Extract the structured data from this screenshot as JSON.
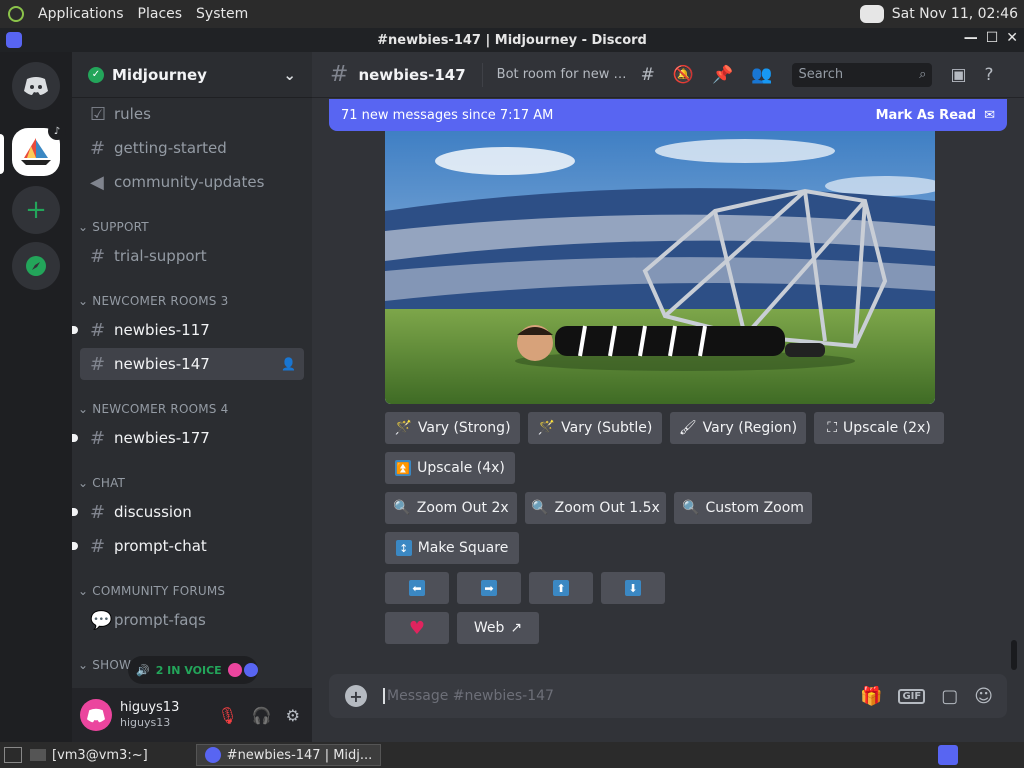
{
  "system_bar": {
    "menus": [
      "Applications",
      "Places",
      "System"
    ],
    "clock": "Sat Nov 11, 02:46"
  },
  "window": {
    "title": "#newbies-147 | Midjourney - Discord",
    "controls": [
      "—",
      "☐",
      "✕"
    ]
  },
  "server": {
    "name": "Midjourney"
  },
  "channels": {
    "top": [
      {
        "name": "rules",
        "icon": "rules-icon"
      },
      {
        "name": "getting-started",
        "icon": "hash-icon"
      },
      {
        "name": "community-updates",
        "icon": "megaphone-icon"
      }
    ],
    "support": {
      "label": "SUPPORT",
      "items": [
        "trial-support"
      ]
    },
    "newcomer3": {
      "label": "NEWCOMER ROOMS 3",
      "items": [
        "newbies-117",
        "newbies-147"
      ]
    },
    "newcomer4": {
      "label": "NEWCOMER ROOMS 4",
      "items": [
        "newbies-177"
      ]
    },
    "chat": {
      "label": "CHAT",
      "items": [
        "discussion",
        "prompt-chat"
      ]
    },
    "forums": {
      "label": "COMMUNITY FORUMS",
      "items": [
        "prompt-faqs"
      ]
    },
    "showcase": {
      "label": "SHOWC"
    }
  },
  "voice_chip": {
    "text": "2 IN VOICE"
  },
  "user": {
    "name": "higuys13",
    "tag": "higuys13"
  },
  "header": {
    "channel": "newbies-147",
    "topic": "Bot room for new us...",
    "search_placeholder": "Search"
  },
  "banner": {
    "text": "71 new messages since 7:17 AM",
    "action": "Mark As Read"
  },
  "buttons": {
    "vary_strong": "Vary (Strong)",
    "vary_subtle": "Vary (Subtle)",
    "vary_region": "Vary (Region)",
    "upscale_2x": "Upscale (2x)",
    "upscale_4x": "Upscale (4x)",
    "zoom_out_2x": "Zoom Out 2x",
    "zoom_out_15x": "Zoom Out 1.5x",
    "custom_zoom": "Custom Zoom",
    "make_square": "Make Square",
    "web": "Web"
  },
  "composer": {
    "placeholder": "Message #newbies-147"
  },
  "taskbar": {
    "items": [
      "[vm3@vm3:~]",
      "#newbies-147 | Midj..."
    ]
  },
  "colors": {
    "blurple": "#5865f2",
    "bg_main": "#313338",
    "bg_sidebar": "#2b2d31",
    "button": "#4e5058",
    "online_green": "#23a55a"
  }
}
